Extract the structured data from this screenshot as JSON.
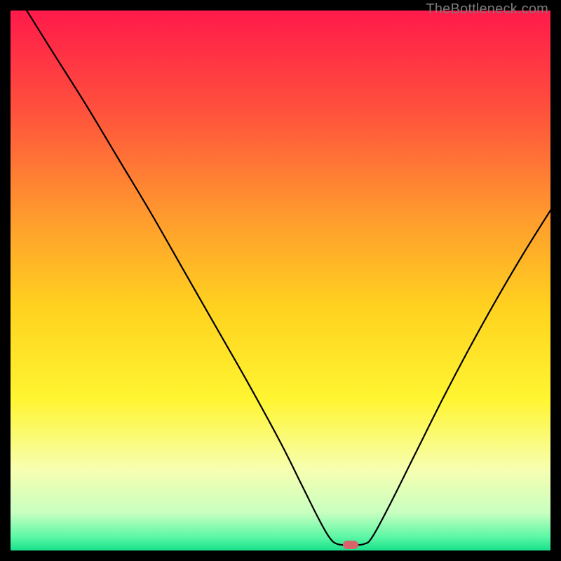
{
  "watermark": "TheBottleneck.com",
  "chart_data": {
    "type": "line",
    "title": "",
    "xlabel": "",
    "ylabel": "",
    "xlim": [
      0,
      100
    ],
    "ylim": [
      0,
      100
    ],
    "grid": false,
    "legend": false,
    "background_gradient": {
      "stops": [
        {
          "pos": 0.0,
          "color": "#ff1a4b"
        },
        {
          "pos": 0.18,
          "color": "#ff4f3d"
        },
        {
          "pos": 0.38,
          "color": "#ff9a2e"
        },
        {
          "pos": 0.55,
          "color": "#ffd21f"
        },
        {
          "pos": 0.72,
          "color": "#fff531"
        },
        {
          "pos": 0.85,
          "color": "#f7ffb0"
        },
        {
          "pos": 0.93,
          "color": "#c8ffc0"
        },
        {
          "pos": 0.975,
          "color": "#5bf7a5"
        },
        {
          "pos": 1.0,
          "color": "#18e08a"
        }
      ]
    },
    "series": [
      {
        "name": "bottleneck-curve",
        "stroke": "#000000",
        "stroke_width": 2.2,
        "points": [
          {
            "x": 3.0,
            "y": 100.0
          },
          {
            "x": 8.0,
            "y": 92.0
          },
          {
            "x": 14.0,
            "y": 82.5
          },
          {
            "x": 20.0,
            "y": 72.5
          },
          {
            "x": 26.0,
            "y": 62.5
          },
          {
            "x": 32.0,
            "y": 52.0
          },
          {
            "x": 38.0,
            "y": 41.5
          },
          {
            "x": 44.0,
            "y": 31.0
          },
          {
            "x": 50.0,
            "y": 20.0
          },
          {
            "x": 54.0,
            "y": 12.0
          },
          {
            "x": 57.0,
            "y": 6.0
          },
          {
            "x": 59.0,
            "y": 2.5
          },
          {
            "x": 60.5,
            "y": 1.2
          },
          {
            "x": 63.0,
            "y": 1.0
          },
          {
            "x": 65.5,
            "y": 1.2
          },
          {
            "x": 67.0,
            "y": 2.5
          },
          {
            "x": 70.0,
            "y": 8.0
          },
          {
            "x": 75.0,
            "y": 18.0
          },
          {
            "x": 80.0,
            "y": 28.0
          },
          {
            "x": 85.0,
            "y": 37.5
          },
          {
            "x": 90.0,
            "y": 46.5
          },
          {
            "x": 95.0,
            "y": 55.0
          },
          {
            "x": 100.0,
            "y": 63.0
          }
        ]
      }
    ],
    "marker": {
      "name": "optimal-point",
      "x": 63.0,
      "y": 1.0,
      "color": "#d9636a"
    }
  }
}
